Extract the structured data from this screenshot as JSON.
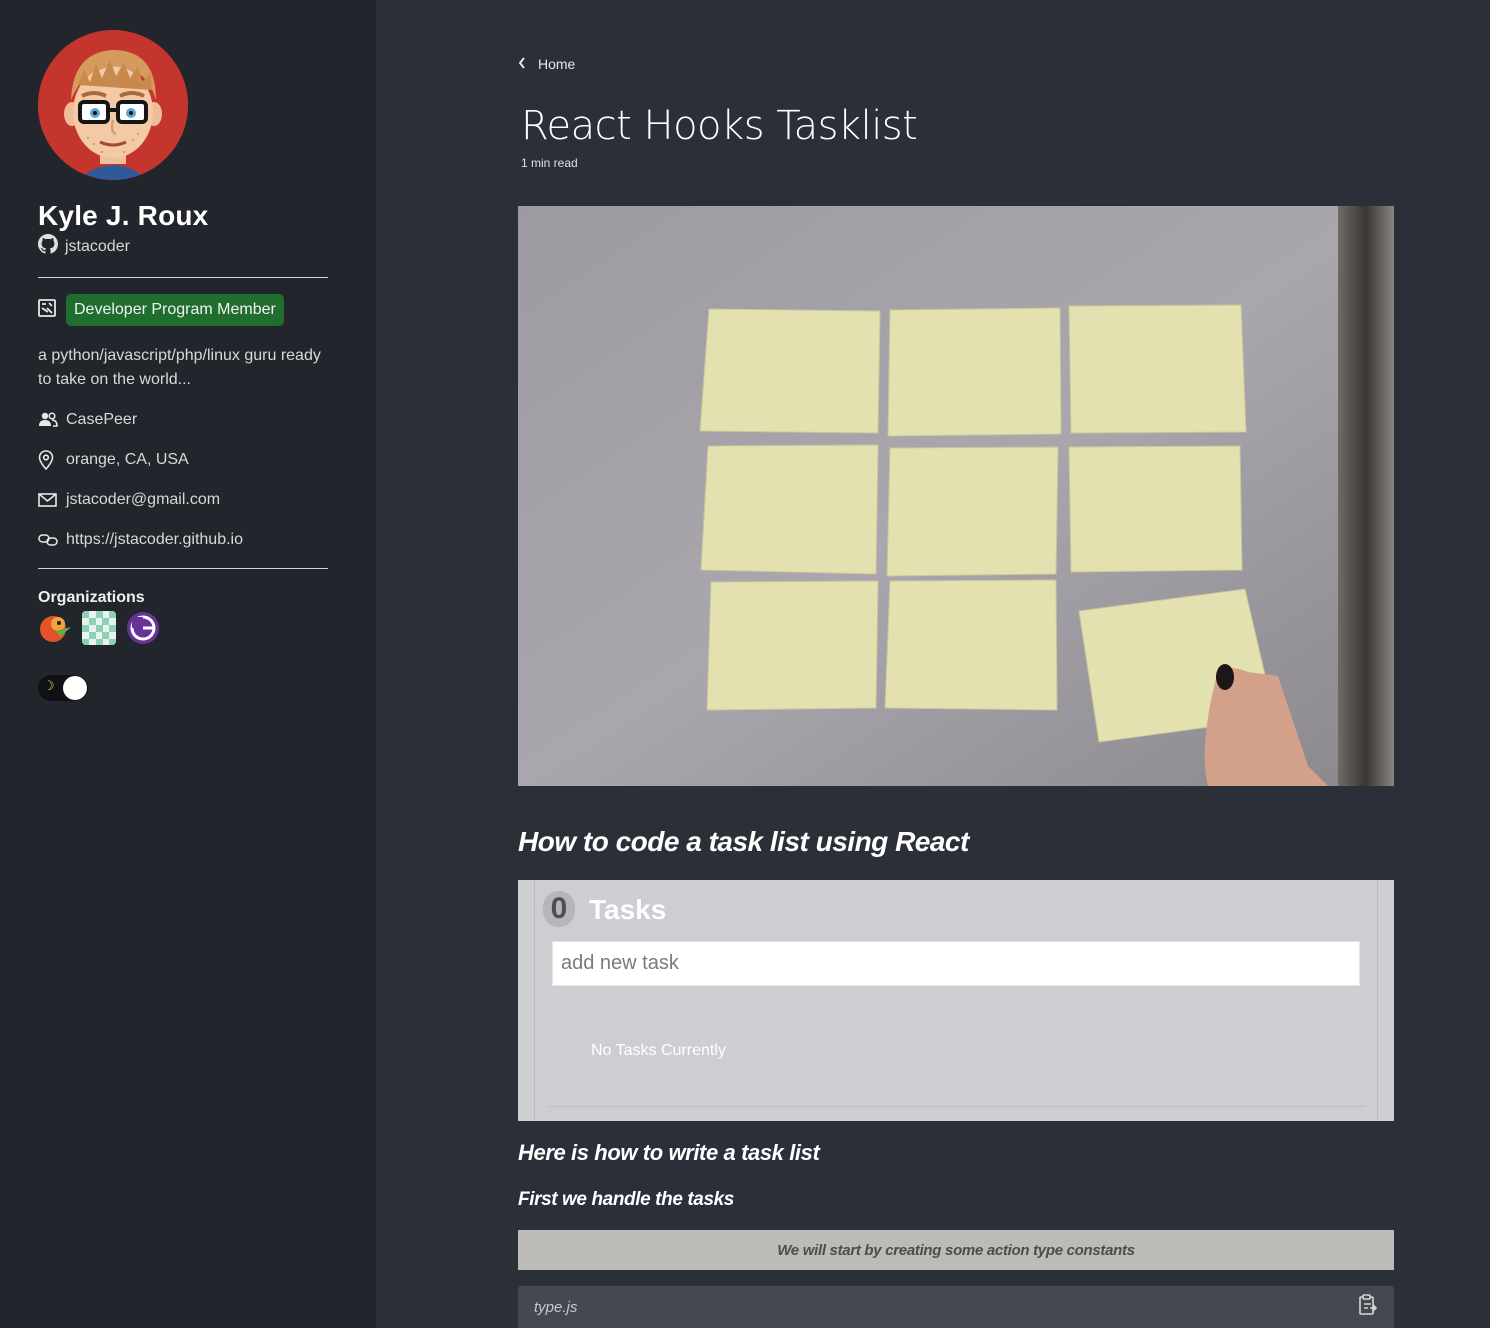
{
  "profile": {
    "name": "Kyle J. Roux",
    "handle": "jstacoder",
    "badge": "Developer Program Member",
    "bio": "a python/javascript/php/linux guru ready to take on the world...",
    "company": "CasePeer",
    "location": "orange, CA, USA",
    "email": "jstacoder@gmail.com",
    "website": "https://jstacoder.github.io",
    "organizations_title": "Organizations"
  },
  "post": {
    "back_label": "Home",
    "title": "React Hooks Tasklist",
    "read_time": "1 min read",
    "subtitle": "How to code a task list using React",
    "heading2": "Here is how to write a task list",
    "heading3": "First we handle the tasks",
    "note": "We will start by creating some action type constants",
    "code_filename": "type.js"
  },
  "demo": {
    "count": "0",
    "label": "Tasks",
    "input_placeholder": "add new task",
    "empty_message": "No Tasks Currently"
  },
  "colors": {
    "sidebar_bg": "#22262c",
    "main_bg": "#2b2f38",
    "badge_bg": "#1f6e2e",
    "demo_bg": "#ccced2"
  },
  "icons": {
    "github": "github-icon",
    "badge": "dev-program-icon",
    "company": "people-icon",
    "location": "location-pin-icon",
    "email": "mail-icon",
    "website": "link-icon",
    "back": "chevron-left-icon",
    "copy": "clipboard-icon",
    "theme": "moon-icon"
  }
}
